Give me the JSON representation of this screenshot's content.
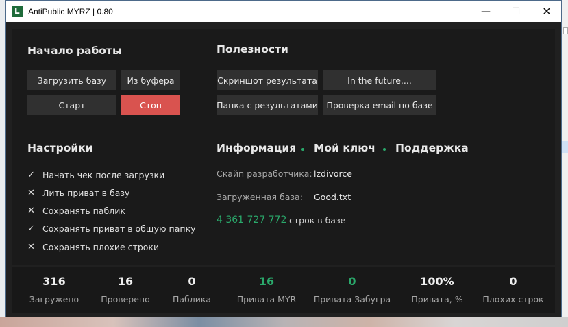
{
  "window": {
    "title": "AntiPublic MYRZ | 0.80",
    "minimize_glyph": "—",
    "maximize_glyph": "☐",
    "close_glyph": "✕"
  },
  "start": {
    "heading": "Начало работы",
    "load_db": "Загрузить базу",
    "from_buffer": "Из буфера",
    "start": "Старт",
    "stop": "Стоп"
  },
  "utils": {
    "heading": "Полезности",
    "screenshot": "Скриншот результата",
    "future": "In the future....",
    "results_folder": "Папка с результатами",
    "check_email": "Проверка email по базе"
  },
  "settings": {
    "heading": "Настройки",
    "options": [
      {
        "mark": "✓",
        "label": "Начать чек после загрузки"
      },
      {
        "mark": "✕",
        "label": "Лить приват в базу"
      },
      {
        "mark": "✕",
        "label": "Сохранять паблик"
      },
      {
        "mark": "✓",
        "label": "Сохранять приват в общую папку"
      },
      {
        "mark": "✕",
        "label": "Сохранять плохие строки"
      }
    ]
  },
  "info": {
    "tab_info": "Информация",
    "tab_key": "Мой ключ",
    "tab_support": "Поддержка",
    "dev_skype_label": "Скайп разработчика:",
    "dev_skype_value": "lzdivorce",
    "loaded_db_label": "Загруженная база:",
    "loaded_db_value": "Good.txt",
    "lines_count": "4 361 727 772",
    "lines_suffix": "строк в базе",
    "accent_color": "#2aa96b"
  },
  "stats": [
    {
      "value": "316",
      "label": "Загружено",
      "green": false
    },
    {
      "value": "16",
      "label": "Проверено",
      "green": false
    },
    {
      "value": "0",
      "label": "Паблика",
      "green": false
    },
    {
      "value": "16",
      "label": "Привата MYR",
      "green": true
    },
    {
      "value": "0",
      "label": "Привата Забугра",
      "green": true
    },
    {
      "value": "100%",
      "label": "Привата, %",
      "green": false
    },
    {
      "value": "0",
      "label": "Плохих строк",
      "green": false
    }
  ]
}
